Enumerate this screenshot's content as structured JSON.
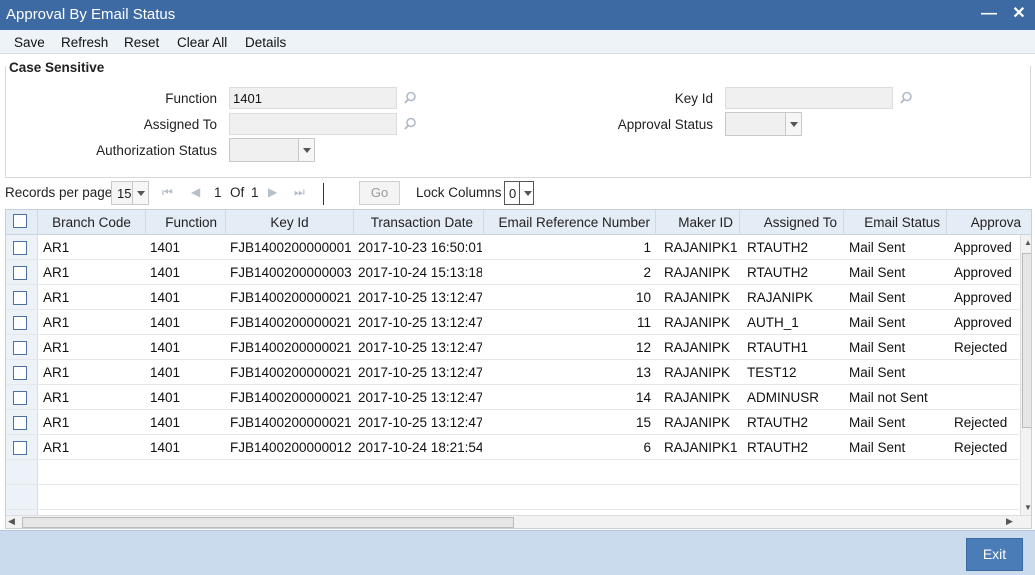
{
  "window": {
    "title": "Approval By Email Status",
    "minimize_label": "—",
    "close_label": "✕"
  },
  "menu": {
    "items": [
      "Save",
      "Refresh",
      "Reset",
      "Clear All",
      "Details"
    ]
  },
  "form": {
    "section_title": "Case Sensitive",
    "function_label": "Function",
    "function_value": "1401",
    "assigned_to_label": "Assigned To",
    "assigned_to_value": "",
    "authorization_status_label": "Authorization Status",
    "authorization_status_value": "",
    "key_id_label": "Key Id",
    "key_id_value": "",
    "approval_status_label": "Approval Status",
    "approval_status_value": ""
  },
  "pager": {
    "records_per_page_label": "Records per page",
    "records_per_page_value": "15",
    "current_page": "1",
    "of_label": "Of",
    "total_pages": "1",
    "go_label": "Go",
    "lock_columns_label": "Lock Columns",
    "lock_columns_value": "0"
  },
  "grid": {
    "columns": [
      "Branch Code",
      "Function",
      "Key Id",
      "Transaction Date",
      "Email Reference Number",
      "Maker ID",
      "Assigned To",
      "Email Status",
      "Approva"
    ],
    "rows": [
      [
        "AR1",
        "1401",
        "FJB1400200000001",
        "2017-10-23 16:50:01",
        "1",
        "RAJANIPK1",
        "RTAUTH2",
        "Mail Sent",
        "Approved"
      ],
      [
        "AR1",
        "1401",
        "FJB1400200000003",
        "2017-10-24 15:13:18",
        "2",
        "RAJANIPK",
        "RTAUTH2",
        "Mail Sent",
        "Approved"
      ],
      [
        "AR1",
        "1401",
        "FJB1400200000021",
        "2017-10-25 13:12:47",
        "10",
        "RAJANIPK",
        "RAJANIPK",
        "Mail Sent",
        "Approved"
      ],
      [
        "AR1",
        "1401",
        "FJB1400200000021",
        "2017-10-25 13:12:47",
        "11",
        "RAJANIPK",
        "AUTH_1",
        "Mail Sent",
        "Approved"
      ],
      [
        "AR1",
        "1401",
        "FJB1400200000021",
        "2017-10-25 13:12:47",
        "12",
        "RAJANIPK",
        "RTAUTH1",
        "Mail Sent",
        "Rejected"
      ],
      [
        "AR1",
        "1401",
        "FJB1400200000021",
        "2017-10-25 13:12:47",
        "13",
        "RAJANIPK",
        "TEST12",
        "Mail Sent",
        ""
      ],
      [
        "AR1",
        "1401",
        "FJB1400200000021",
        "2017-10-25 13:12:47",
        "14",
        "RAJANIPK",
        "ADMINUSR",
        "Mail not Sent",
        ""
      ],
      [
        "AR1",
        "1401",
        "FJB1400200000021",
        "2017-10-25 13:12:47",
        "15",
        "RAJANIPK",
        "RTAUTH2",
        "Mail Sent",
        "Rejected"
      ],
      [
        "AR1",
        "1401",
        "FJB1400200000012",
        "2017-10-24 18:21:54",
        "6",
        "RAJANIPK1",
        "RTAUTH2",
        "Mail Sent",
        "Rejected"
      ]
    ]
  },
  "footer": {
    "exit_label": "Exit"
  }
}
